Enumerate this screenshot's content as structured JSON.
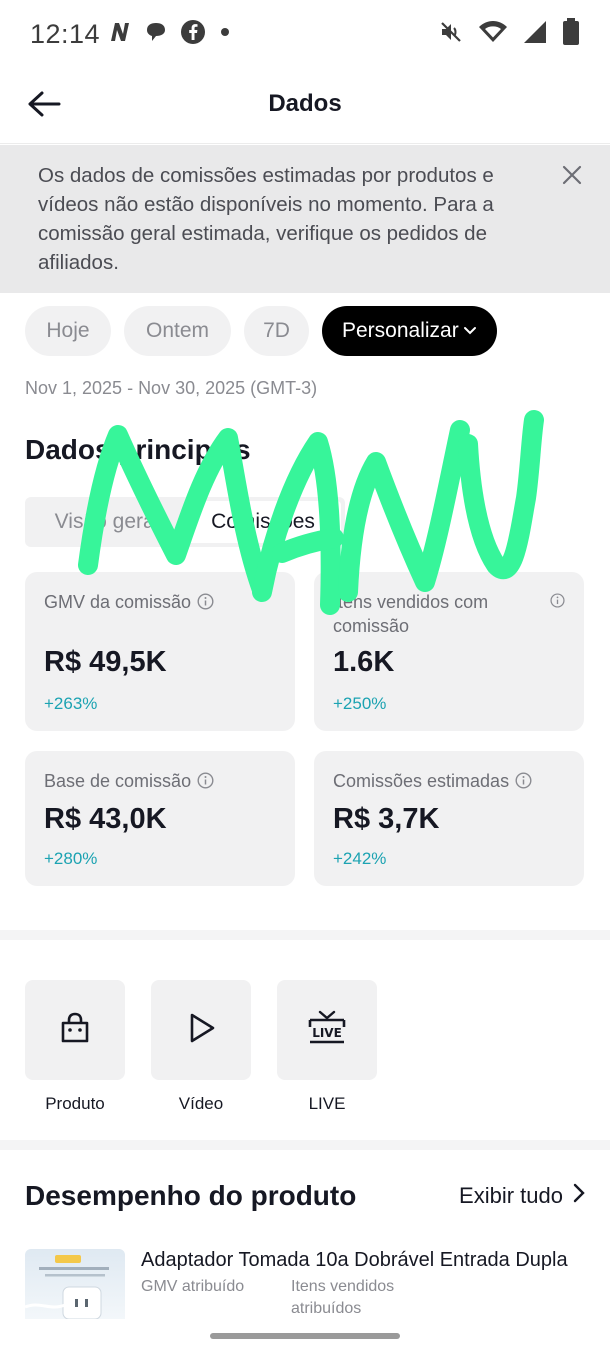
{
  "status_bar": {
    "time": "12:14",
    "left_icons": [
      "n-app-icon",
      "chat-bubble-icon",
      "facebook-icon",
      "dot-icon"
    ],
    "right_icons": [
      "mute-icon",
      "wifi-icon",
      "signal-icon",
      "battery-icon"
    ]
  },
  "nav": {
    "title": "Dados"
  },
  "notice": {
    "text": "Os dados de comissões estimadas por produtos e vídeos não estão disponíveis no momento. Para a comissão geral estimada, verifique os pedidos de afiliados."
  },
  "filters": {
    "options": [
      "Hoje",
      "Ontem",
      "7D",
      "Personalizar"
    ],
    "selected": "Personalizar"
  },
  "date_range": "Nov 1, 2025 - Nov 30, 2025 (GMT-3)",
  "main": {
    "section_title": "Dados principais",
    "segments": [
      "Visão geral",
      "Comissões"
    ],
    "selected_segment": "Comissões",
    "metrics": [
      {
        "label": "GMV da comissão",
        "value": "R$ 49,5K",
        "delta": "+263%"
      },
      {
        "label": "Itens vendidos com comissão",
        "value": "1.6K",
        "delta": "+250%"
      },
      {
        "label": "Base de comissão",
        "value": "R$ 43,0K",
        "delta": "+280%"
      },
      {
        "label": "Comissões estimadas",
        "value": "R$ 3,7K",
        "delta": "+242%"
      }
    ]
  },
  "shortcuts": [
    {
      "label": "Produto",
      "icon": "shopping-bag-icon"
    },
    {
      "label": "Vídeo",
      "icon": "play-icon"
    },
    {
      "label": "LIVE",
      "icon": "live-tv-icon"
    }
  ],
  "performance": {
    "title": "Desempenho do produto",
    "view_all": "Exibir tudo",
    "products": [
      {
        "name": "Adaptador Tomada 10a Dobrável Entrada Dupla",
        "col1": "GMV atribuído",
        "col2": "Itens vendidos atribuídos"
      }
    ]
  },
  "overlay": {
    "handwriting": "MANU",
    "color": "#37f59a"
  },
  "colors": {
    "accent_delta": "#1ca3b2",
    "chip_active_bg": "#000000",
    "card_bg": "#f1f1f2"
  }
}
